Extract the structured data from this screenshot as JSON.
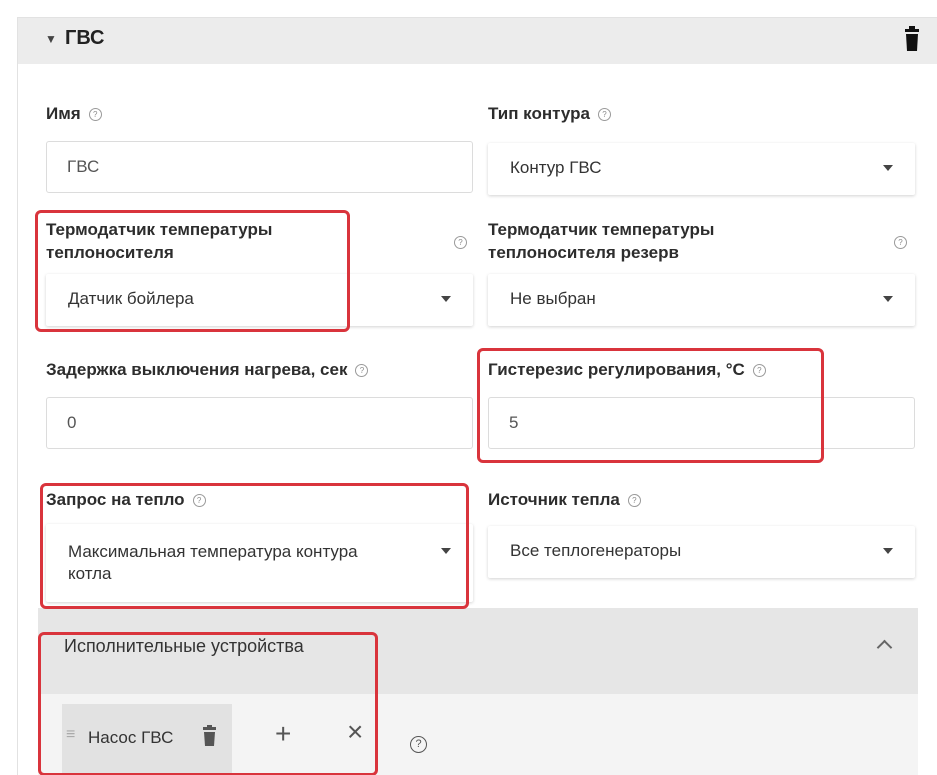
{
  "section": {
    "title": "ГВС"
  },
  "fields": {
    "name": {
      "label": "Имя",
      "value": "ГВС"
    },
    "circuit_type": {
      "label": "Тип контура",
      "value": "Контур ГВС"
    },
    "sensor": {
      "label_line1": "Термодатчик температуры",
      "label_line2": "теплоносителя",
      "value": "Датчик бойлера"
    },
    "sensor_reserve": {
      "label_line1": "Термодатчик температуры",
      "label_line2": "теплоносителя резерв",
      "value": "Не выбран"
    },
    "delay": {
      "label": "Задержка выключения нагрева, сек",
      "value": "0"
    },
    "hysteresis": {
      "label": "Гистерезис регулирования, °C",
      "value": "5"
    },
    "heat_request": {
      "label": "Запрос на тепло",
      "value_line1": "Максимальная температура контура",
      "value_line2": "котла"
    },
    "heat_source": {
      "label": "Источник тепла",
      "value": "Все теплогенераторы"
    }
  },
  "actuators": {
    "title": "Исполнительные устройства",
    "items": [
      {
        "label": "Насос ГВС"
      }
    ],
    "add_symbol": "+",
    "remove_symbol": "×"
  },
  "help_symbol": "?",
  "colors": {
    "highlight": "#d9343c",
    "header_bg": "#ececec"
  },
  "icons": [
    "drag-handle-icon",
    "caret-down-icon",
    "trash-icon",
    "help-icon",
    "dropdown-arrow-icon",
    "chevron-up-icon",
    "plus-icon",
    "close-icon"
  ]
}
